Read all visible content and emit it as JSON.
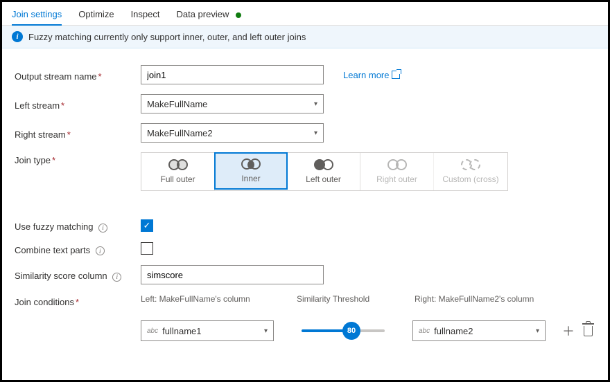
{
  "tabs": {
    "join_settings": "Join settings",
    "optimize": "Optimize",
    "inspect": "Inspect",
    "data_preview": "Data preview"
  },
  "info_bar": "Fuzzy matching currently only support inner, outer, and left outer joins",
  "labels": {
    "output_stream": "Output stream name",
    "left_stream": "Left stream",
    "right_stream": "Right stream",
    "join_type": "Join type",
    "use_fuzzy": "Use fuzzy matching",
    "combine_parts": "Combine text parts",
    "sim_score_col": "Similarity score column",
    "join_conditions": "Join conditions"
  },
  "values": {
    "output_stream": "join1",
    "left_stream": "MakeFullName",
    "right_stream": "MakeFullName2",
    "sim_score_col": "simscore",
    "use_fuzzy_checked": true,
    "combine_parts_checked": false,
    "selected_join_type": "inner"
  },
  "learn_more": "Learn more",
  "join_types": {
    "full_outer": "Full outer",
    "inner": "Inner",
    "left_outer": "Left outer",
    "right_outer": "Right outer",
    "custom": "Custom (cross)"
  },
  "cond": {
    "left_header": "Left: MakeFullName's column",
    "threshold_header": "Similarity Threshold",
    "right_header": "Right: MakeFullName2's column",
    "left_col_type": "abc",
    "left_col": "fullname1",
    "right_col_type": "abc",
    "right_col": "fullname2",
    "threshold_value": "80"
  }
}
